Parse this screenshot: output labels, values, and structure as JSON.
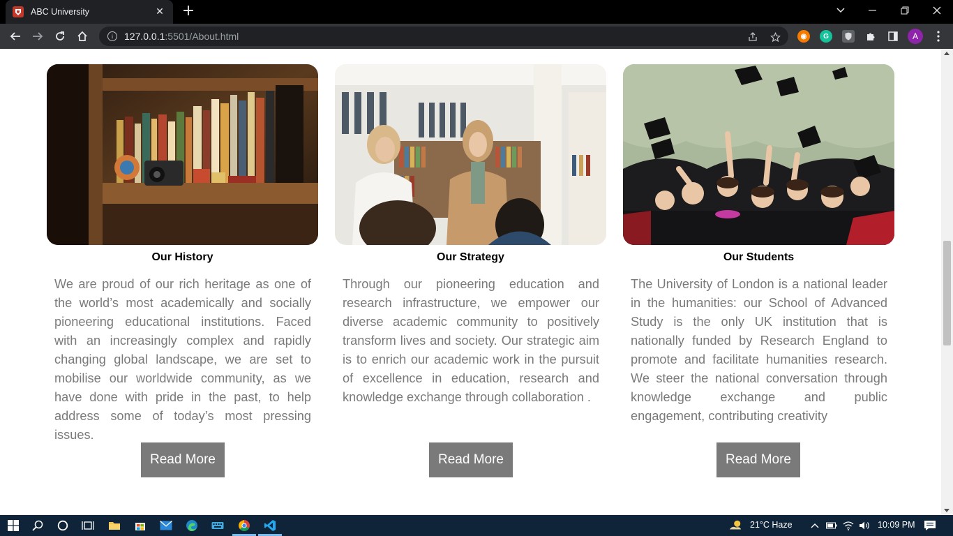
{
  "browser": {
    "tab_title": "ABC University",
    "url_host": "127.0.0.1",
    "url_path": ":5501/About.html",
    "profile_initial": "A"
  },
  "cards": [
    {
      "title": "Our History",
      "text": "We are proud of our rich heritage as one of the world’s most academically and socially pioneering educational institutions. Faced with an increasingly complex and rapidly changing global landscape, we are set to mobilise our worldwide community, as we have done with pride in the past, to help address some of today’s most pressing issues.",
      "button": "Read More",
      "image": "bookshelf-photo"
    },
    {
      "title": "Our Strategy",
      "text": "Through our pioneering education and research infrastructure, we empower our diverse academic community to positively transform lives and society. Our strategic aim is to enrich our academic work in the pursuit of excellence in education, research and knowledge exchange through collaboration .",
      "button": "Read More",
      "image": "library-discussion-photo"
    },
    {
      "title": "Our Students",
      "text": "The University of London is a national leader in the humanities: our School of Advanced Study is the only UK institution that is nationally funded by Research England to promote and facilitate humanities research. We steer the national conversation through knowledge exchange and public engagement, contributing creativity",
      "button": "Read More",
      "image": "graduation-caps-photo"
    }
  ],
  "taskbar": {
    "weather": "21°C  Haze",
    "time": "10:09 PM"
  },
  "colors": {
    "button_bg": "#7a7a7a",
    "body_text": "#7a7a7a",
    "chrome_dark": "#35363a"
  }
}
